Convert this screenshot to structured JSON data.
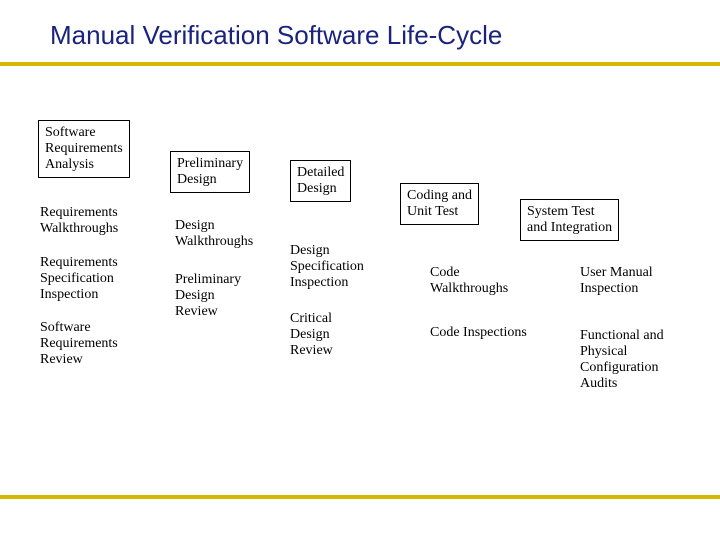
{
  "title": "Manual Verification Software Life-Cycle",
  "boxes": {
    "sra": "Software\nRequirements\nAnalysis",
    "pd": "Preliminary\nDesign",
    "dd": "Detailed\nDesign",
    "cut": "Coding and\nUnit Test",
    "sti": "System Test\nand Integration"
  },
  "labels": {
    "rw": "Requirements\nWalkthroughs",
    "rsi": "Requirements\nSpecification\nInspection",
    "srr": "Software\nRequirements\nReview",
    "dw": "Design\nWalkthroughs",
    "pdr": "Preliminary\nDesign\nReview",
    "dsi": "Design\nSpecification\nInspection",
    "cdr": "Critical\nDesign\nReview",
    "cw": "Code\nWalkthroughs",
    "ci": "Code Inspections",
    "umi": "User Manual\nInspection",
    "fpca": "Functional and\nPhysical\nConfiguration\nAudits"
  }
}
